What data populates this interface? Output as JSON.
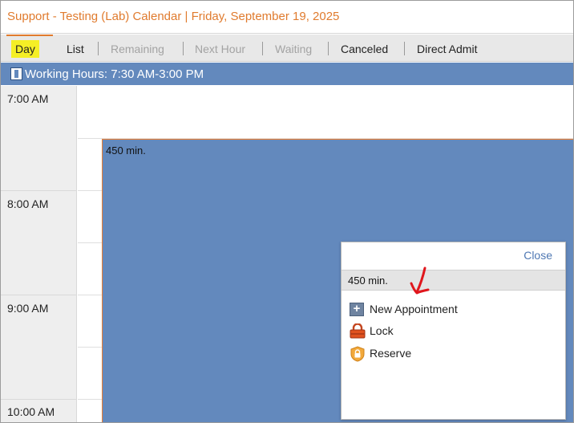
{
  "header": {
    "title": "Support - Testing (Lab) Calendar | Friday, September 19, 2025"
  },
  "tabs": [
    {
      "label": "Day",
      "active": true
    },
    {
      "label": "List"
    },
    {
      "label": "Remaining",
      "disabled": true
    },
    {
      "label": "Next Hour",
      "disabled": true
    },
    {
      "label": "Waiting",
      "disabled": true
    },
    {
      "label": "Canceled"
    },
    {
      "label": "Direct Admit"
    }
  ],
  "working_hours": {
    "text": "Working Hours: 7:30 AM-3:00 PM",
    "icon": "info-square-icon"
  },
  "times": [
    "7:00 AM",
    "8:00 AM",
    "9:00 AM",
    "10:00 AM"
  ],
  "block": {
    "duration_label": "450 min.",
    "color": "#6389bd",
    "border_color": "#ef7f33"
  },
  "popup": {
    "close_label": "Close",
    "duration_label": "450 min.",
    "items": [
      {
        "label": "New Appointment",
        "icon": "plus-icon"
      },
      {
        "label": "Lock",
        "icon": "lock-icon"
      },
      {
        "label": "Reserve",
        "icon": "reserve-shield-icon"
      }
    ]
  },
  "colors": {
    "title": "#e07b2e",
    "highlight": "#f5ef25",
    "annotation": "#e0161c",
    "link": "#4f78b3"
  }
}
